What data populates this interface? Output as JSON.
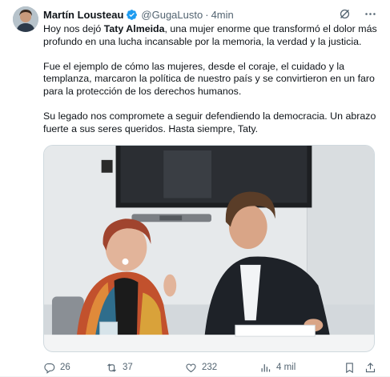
{
  "author": {
    "name": "Martín Lousteau",
    "handle": "@GugaLusto",
    "separator": "·",
    "time": "4min"
  },
  "text": {
    "p1_before": "Hoy nos dejó ",
    "p1_bold": "Taty Almeida",
    "p1_after": ", una mujer enorme que transformó el dolor más profundo en una lucha incansable por la memoria, la verdad y la justicia.",
    "p2": "Fue el ejemplo de cómo las mujeres, desde el coraje, el cuidado y la templanza, marcaron la política de nuestro país y se convirtieron en un faro para la protección de los derechos humanos.",
    "p3": "Su legado nos compromete a seguir defendiendo la democracia. Un abrazo fuerte a sus seres queridos. Hasta siempre, Taty."
  },
  "actions": {
    "replies": "26",
    "reposts": "37",
    "likes": "232",
    "views": "4 mil"
  },
  "icons": {
    "verified": "verified-badge-icon",
    "grok": "grok-icon",
    "more": "more-icon",
    "reply": "reply-icon",
    "repost": "repost-icon",
    "like": "heart-icon",
    "views": "views-icon",
    "bookmark": "bookmark-icon",
    "share": "share-icon"
  },
  "colors": {
    "text": "#0f1419",
    "secondary": "#536471",
    "verified": "#1d9bf0"
  }
}
